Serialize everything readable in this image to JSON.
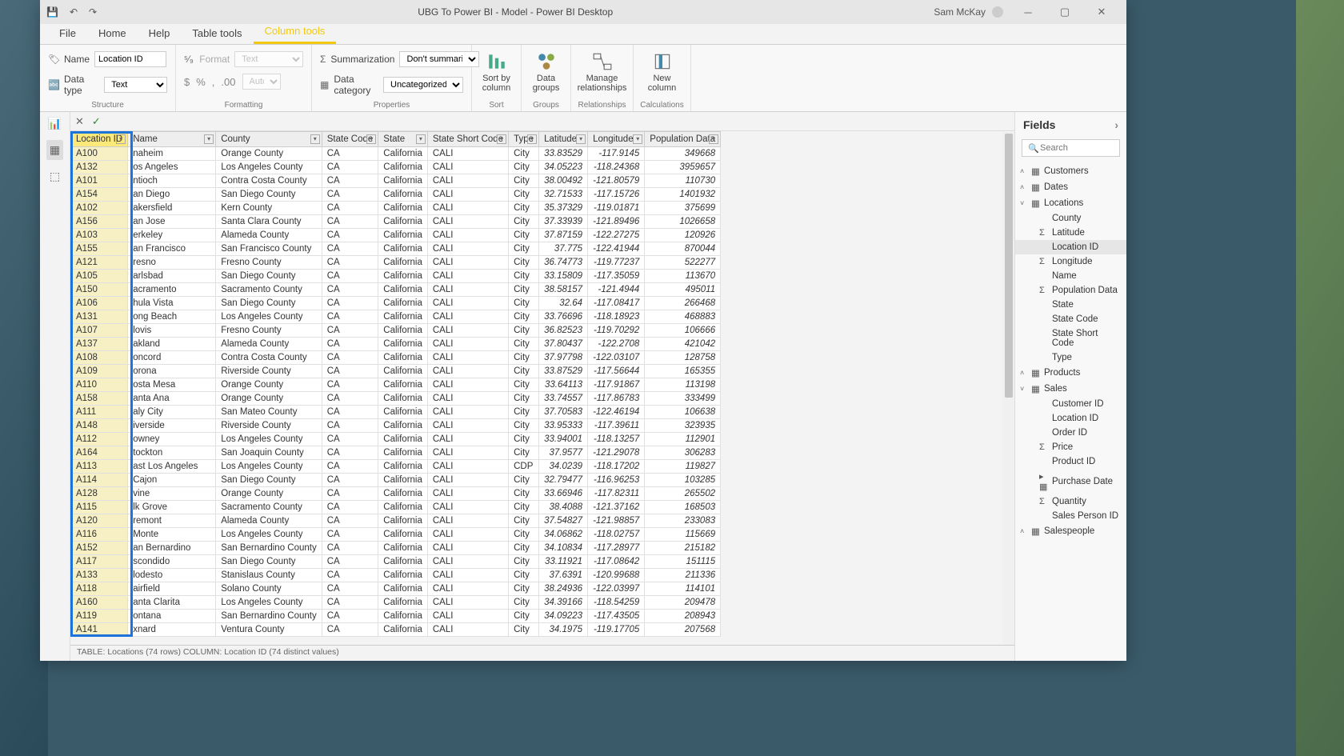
{
  "title": "UBG To Power BI - Model - Power BI Desktop",
  "user": "Sam McKay",
  "tabs": [
    "File",
    "Home",
    "Help",
    "Table tools",
    "Column tools"
  ],
  "active_tab": 4,
  "structure": {
    "name_label": "Name",
    "name_value": "Location ID",
    "datatype_label": "Data type",
    "datatype_value": "Text",
    "group": "Structure"
  },
  "formatting": {
    "format_label": "Format",
    "format_value": "Text",
    "auto": "Auto",
    "group": "Formatting"
  },
  "properties": {
    "sum_label": "Summarization",
    "sum_value": "Don't summarize",
    "cat_label": "Data category",
    "cat_value": "Uncategorized",
    "group": "Properties"
  },
  "sort": {
    "label": "Sort by column",
    "group": "Sort"
  },
  "groups": {
    "label": "Data groups",
    "group": "Groups"
  },
  "rel": {
    "label": "Manage relationships",
    "group": "Relationships"
  },
  "calc": {
    "label": "New column",
    "group": "Calculations"
  },
  "fields_header": "Fields",
  "search_placeholder": "Search",
  "tables": [
    {
      "name": "Customers",
      "expanded": false
    },
    {
      "name": "Dates",
      "expanded": false
    },
    {
      "name": "Locations",
      "expanded": true,
      "fields": [
        {
          "name": "County"
        },
        {
          "name": "Latitude",
          "sigma": true
        },
        {
          "name": "Location ID",
          "sel": true
        },
        {
          "name": "Longitude",
          "sigma": true
        },
        {
          "name": "Name"
        },
        {
          "name": "Population Data",
          "sigma": true
        },
        {
          "name": "State"
        },
        {
          "name": "State Code"
        },
        {
          "name": "State Short Code"
        },
        {
          "name": "Type"
        }
      ]
    },
    {
      "name": "Products",
      "expanded": false
    },
    {
      "name": "Sales",
      "expanded": true,
      "fields": [
        {
          "name": "Customer ID"
        },
        {
          "name": "Location ID"
        },
        {
          "name": "Order ID"
        },
        {
          "name": "Price",
          "sigma": true
        },
        {
          "name": "Product ID"
        },
        {
          "name": "Purchase Date",
          "calendar": true
        },
        {
          "name": "Quantity",
          "sigma": true
        },
        {
          "name": "Sales Person ID"
        }
      ]
    },
    {
      "name": "Salespeople",
      "expanded": false
    }
  ],
  "columns": [
    "Location ID",
    "Name",
    "County",
    "State Code",
    "State",
    "State Short Code",
    "Type",
    "Latitude",
    "Longitude",
    "Population Data"
  ],
  "selected_col": 0,
  "rows": [
    [
      "A100",
      "naheim",
      "Orange County",
      "CA",
      "California",
      "CALI",
      "City",
      "33.83529",
      "-117.9145",
      "349668"
    ],
    [
      "A132",
      "os Angeles",
      "Los Angeles County",
      "CA",
      "California",
      "CALI",
      "City",
      "34.05223",
      "-118.24368",
      "3959657"
    ],
    [
      "A101",
      "ntioch",
      "Contra Costa County",
      "CA",
      "California",
      "CALI",
      "City",
      "38.00492",
      "-121.80579",
      "110730"
    ],
    [
      "A154",
      "an Diego",
      "San Diego County",
      "CA",
      "California",
      "CALI",
      "City",
      "32.71533",
      "-117.15726",
      "1401932"
    ],
    [
      "A102",
      "akersfield",
      "Kern County",
      "CA",
      "California",
      "CALI",
      "City",
      "35.37329",
      "-119.01871",
      "375699"
    ],
    [
      "A156",
      "an Jose",
      "Santa Clara County",
      "CA",
      "California",
      "CALI",
      "City",
      "37.33939",
      "-121.89496",
      "1026658"
    ],
    [
      "A103",
      "erkeley",
      "Alameda County",
      "CA",
      "California",
      "CALI",
      "City",
      "37.87159",
      "-122.27275",
      "120926"
    ],
    [
      "A155",
      "an Francisco",
      "San Francisco County",
      "CA",
      "California",
      "CALI",
      "City",
      "37.775",
      "-122.41944",
      "870044"
    ],
    [
      "A121",
      "resno",
      "Fresno County",
      "CA",
      "California",
      "CALI",
      "City",
      "36.74773",
      "-119.77237",
      "522277"
    ],
    [
      "A105",
      "arlsbad",
      "San Diego County",
      "CA",
      "California",
      "CALI",
      "City",
      "33.15809",
      "-117.35059",
      "113670"
    ],
    [
      "A150",
      "acramento",
      "Sacramento County",
      "CA",
      "California",
      "CALI",
      "City",
      "38.58157",
      "-121.4944",
      "495011"
    ],
    [
      "A106",
      "hula Vista",
      "San Diego County",
      "CA",
      "California",
      "CALI",
      "City",
      "32.64",
      "-117.08417",
      "266468"
    ],
    [
      "A131",
      "ong Beach",
      "Los Angeles County",
      "CA",
      "California",
      "CALI",
      "City",
      "33.76696",
      "-118.18923",
      "468883"
    ],
    [
      "A107",
      "lovis",
      "Fresno County",
      "CA",
      "California",
      "CALI",
      "City",
      "36.82523",
      "-119.70292",
      "106666"
    ],
    [
      "A137",
      "akland",
      "Alameda County",
      "CA",
      "California",
      "CALI",
      "City",
      "37.80437",
      "-122.2708",
      "421042"
    ],
    [
      "A108",
      "oncord",
      "Contra Costa County",
      "CA",
      "California",
      "CALI",
      "City",
      "37.97798",
      "-122.03107",
      "128758"
    ],
    [
      "A109",
      "orona",
      "Riverside County",
      "CA",
      "California",
      "CALI",
      "City",
      "33.87529",
      "-117.56644",
      "165355"
    ],
    [
      "A110",
      "osta Mesa",
      "Orange County",
      "CA",
      "California",
      "CALI",
      "City",
      "33.64113",
      "-117.91867",
      "113198"
    ],
    [
      "A158",
      "anta Ana",
      "Orange County",
      "CA",
      "California",
      "CALI",
      "City",
      "33.74557",
      "-117.86783",
      "333499"
    ],
    [
      "A111",
      "aly City",
      "San Mateo County",
      "CA",
      "California",
      "CALI",
      "City",
      "37.70583",
      "-122.46194",
      "106638"
    ],
    [
      "A148",
      "iverside",
      "Riverside County",
      "CA",
      "California",
      "CALI",
      "City",
      "33.95333",
      "-117.39611",
      "323935"
    ],
    [
      "A112",
      "owney",
      "Los Angeles County",
      "CA",
      "California",
      "CALI",
      "City",
      "33.94001",
      "-118.13257",
      "112901"
    ],
    [
      "A164",
      "tockton",
      "San Joaquin County",
      "CA",
      "California",
      "CALI",
      "City",
      "37.9577",
      "-121.29078",
      "306283"
    ],
    [
      "A113",
      "ast Los Angeles",
      "Los Angeles County",
      "CA",
      "California",
      "CALI",
      "CDP",
      "34.0239",
      "-118.17202",
      "119827"
    ],
    [
      "A114",
      " Cajon",
      "San Diego County",
      "CA",
      "California",
      "CALI",
      "City",
      "32.79477",
      "-116.96253",
      "103285"
    ],
    [
      "A128",
      "vine",
      "Orange County",
      "CA",
      "California",
      "CALI",
      "City",
      "33.66946",
      "-117.82311",
      "265502"
    ],
    [
      "A115",
      "lk Grove",
      "Sacramento County",
      "CA",
      "California",
      "CALI",
      "City",
      "38.4088",
      "-121.37162",
      "168503"
    ],
    [
      "A120",
      "remont",
      "Alameda County",
      "CA",
      "California",
      "CALI",
      "City",
      "37.54827",
      "-121.98857",
      "233083"
    ],
    [
      "A116",
      " Monte",
      "Los Angeles County",
      "CA",
      "California",
      "CALI",
      "City",
      "34.06862",
      "-118.02757",
      "115669"
    ],
    [
      "A152",
      "an Bernardino",
      "San Bernardino County",
      "CA",
      "California",
      "CALI",
      "City",
      "34.10834",
      "-117.28977",
      "215182"
    ],
    [
      "A117",
      "scondido",
      "San Diego County",
      "CA",
      "California",
      "CALI",
      "City",
      "33.11921",
      "-117.08642",
      "151115"
    ],
    [
      "A133",
      "lodesto",
      "Stanislaus County",
      "CA",
      "California",
      "CALI",
      "City",
      "37.6391",
      "-120.99688",
      "211336"
    ],
    [
      "A118",
      "airfield",
      "Solano County",
      "CA",
      "California",
      "CALI",
      "City",
      "38.24936",
      "-122.03997",
      "114101"
    ],
    [
      "A160",
      "anta Clarita",
      "Los Angeles County",
      "CA",
      "California",
      "CALI",
      "City",
      "34.39166",
      "-118.54259",
      "209478"
    ],
    [
      "A119",
      "ontana",
      "San Bernardino County",
      "CA",
      "California",
      "CALI",
      "City",
      "34.09223",
      "-117.43505",
      "208943"
    ],
    [
      "A141",
      "xnard",
      "Ventura County",
      "CA",
      "California",
      "CALI",
      "City",
      "34.1975",
      "-119.17705",
      "207568"
    ]
  ],
  "status": "TABLE: Locations (74 rows)  COLUMN: Location ID (74 distinct values)"
}
